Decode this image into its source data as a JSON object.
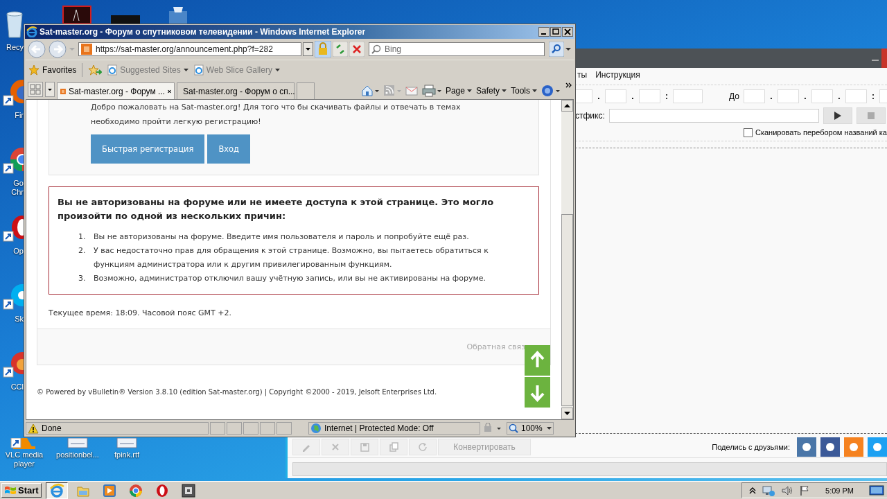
{
  "desktop": {
    "side_icons": [
      {
        "kind": "recycle",
        "label": "Recy"
      },
      {
        "kind": "firefox",
        "label": "Fir"
      },
      {
        "kind": "chrome",
        "label": "Go Chr"
      },
      {
        "kind": "opera",
        "label": "Op"
      },
      {
        "kind": "skype",
        "label": "Sk"
      },
      {
        "kind": "ccleaner",
        "label": "CCl"
      }
    ],
    "top_icons": [
      {
        "kind": "acrobat"
      },
      {
        "kind": "dark"
      },
      {
        "kind": "installer"
      }
    ],
    "bottom_icons": [
      {
        "kind": "vlc",
        "label": "VLC media player"
      },
      {
        "kind": "document",
        "label": "positionbel..."
      },
      {
        "kind": "document",
        "label": "fpink.rtf"
      }
    ]
  },
  "background_app": {
    "menu": [
      "ты",
      "Инструкция"
    ],
    "from_separators": [
      ".",
      ".",
      ":"
    ],
    "to_label": "До",
    "to_separators": [
      ".",
      ".",
      ".",
      ":"
    ],
    "postfix_label": "стфикс:",
    "scan_checkbox": {
      "label": "Сканировать перебором названий ка",
      "checked": false
    },
    "toolbar": [
      {
        "kind": "edit"
      },
      {
        "kind": "delete"
      },
      {
        "kind": "save"
      },
      {
        "kind": "copy"
      },
      {
        "kind": "refresh"
      },
      {
        "kind": "text",
        "label": "Конвертировать"
      }
    ],
    "share_label": "Поделись с друзьями:",
    "progress": {
      "level": 0
    },
    "share_icons": [
      {
        "color": "#4a76a8"
      },
      {
        "color": "#3b5998"
      },
      {
        "color": "#f58220"
      },
      {
        "color": "#1da1f2"
      }
    ]
  },
  "browser": {
    "title": "Sat-master.org - Форум о спутниковом телевидении - Windows Internet Explorer",
    "address": "https://sat-master.org/announcement.php?f=282",
    "search": {
      "placeholder": "Bing"
    },
    "favorites": {
      "label": "Favorites",
      "links": [
        "Suggested Sites",
        "Web Slice Gallery"
      ]
    },
    "tabs": [
      {
        "label": "Sat-master.org - Форум ...",
        "selected": true
      },
      {
        "label": "Sat-master.org - Форум о сп...",
        "selected": false
      }
    ],
    "commands": [
      "Page",
      "Safety",
      "Tools"
    ],
    "page": {
      "welcome_lines": [
        "Добро пожаловать на Sat-master.org! Для того что бы скачивать файлы и отвечать в темах",
        "необходимо пройти легкую регистрацию!"
      ],
      "buttons": [
        "Быстрая регистрация",
        "Вход"
      ],
      "error_title": "Вы не авторизованы на форуме или не имеете доступа к этой странице. Это могло произойти по одной из нескольких причин:",
      "reasons": [
        {
          "number": "1.",
          "text": "Вы не авторизованы на форуме. Введите имя пользователя и пароль и попробуйте ещё раз."
        },
        {
          "number": "2.",
          "text": "У вас недостаточно прав для обращения к этой странице. Возможно, вы пытаетесь обратиться к функциям администратора или к другим привилегированным функциям."
        },
        {
          "number": "3.",
          "text": "Возможно, администратор отключил вашу учётную запись, или вы не активированы на форуме."
        }
      ],
      "time": "Текущее время: 18:09. Часовой пояс GMT +2.",
      "feedback": "Обратная связ",
      "copyright": "© Powered by vBulletin® Version 3.8.10 (edition Sat-master.org) | Copyright ©2000 - 2019, Jelsoft Enterprises Ltd."
    },
    "status_bar": {
      "text": "Done",
      "zone": "Internet | Protected Mode: Off",
      "zoom": "100%"
    }
  },
  "taskbar": {
    "start": "Start",
    "apps": [
      {
        "kind": "ie",
        "selected": true
      },
      {
        "kind": "folder",
        "selected": false
      },
      {
        "kind": "media",
        "selected": false
      },
      {
        "kind": "chrome",
        "selected": false
      },
      {
        "kind": "opera",
        "selected": false
      },
      {
        "kind": "sandbox",
        "selected": false
      }
    ],
    "clock": "5:09 PM"
  }
}
